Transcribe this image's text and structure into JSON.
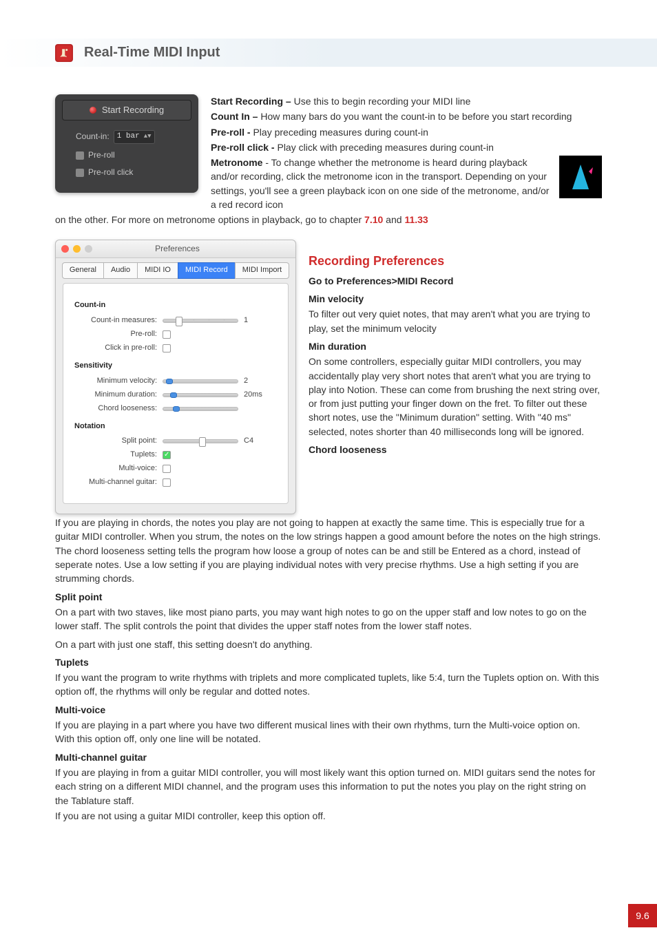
{
  "header": {
    "title": "Real-Time MIDI Input"
  },
  "startPanel": {
    "startBtn": "Start Recording",
    "countInLabel": "Count-in:",
    "countInValue": "1 bar",
    "preRoll": "Pre-roll",
    "preRollClick": "Pre-roll click"
  },
  "intro": {
    "startRec": {
      "b": "Start Recording – ",
      "t": "Use this to begin recording your MIDI line"
    },
    "countIn": {
      "b": "Count In – ",
      "t": "How many bars do you want the count-in to be before you start recording"
    },
    "preRoll": {
      "b": "Pre-roll - ",
      "t": "Play preceding measures during count-in"
    },
    "preRollClick": {
      "b": "Pre-roll click - ",
      "t": "Play click with preceding measures during count-in"
    },
    "metronome": {
      "b": "Metronome",
      "t": " - To change whether the metronome is heard during playback and/or recording, click the metronome icon in the transport. Depending on your settings, you'll see a green playback icon on one side of the metronome, and/or a red record icon"
    },
    "metronomeTail1": "on the other. For more on metronome options in playback, go to chapter ",
    "metronomeRef1": "7.10",
    "metronomeAnd": " and ",
    "metronomeRef2": "11.33"
  },
  "prefs": {
    "title": "Preferences",
    "tabs": [
      "General",
      "Audio",
      "MIDI IO",
      "MIDI Record",
      "MIDI Import"
    ],
    "activeTab": "MIDI Record",
    "groups": {
      "countIn": {
        "title": "Count-in",
        "measures": {
          "label": "Count-in measures:",
          "value": "1"
        },
        "preRoll": {
          "label": "Pre-roll:"
        },
        "clickPre": {
          "label": "Click in pre-roll:"
        }
      },
      "sensitivity": {
        "title": "Sensitivity",
        "minVel": {
          "label": "Minimum velocity:",
          "value": "2"
        },
        "minDur": {
          "label": "Minimum duration:",
          "value": "20ms"
        },
        "chord": {
          "label": "Chord looseness:"
        }
      },
      "notation": {
        "title": "Notation",
        "split": {
          "label": "Split point:",
          "value": "C4"
        },
        "tuplets": {
          "label": "Tuplets:"
        },
        "multiVoice": {
          "label": "Multi-voice:"
        },
        "mcg": {
          "label": "Multi-channel guitar:"
        }
      }
    }
  },
  "rec": {
    "heading": "Recording Preferences",
    "goto": "Go to Preferences>MIDI Record",
    "minVelH": "Min velocity",
    "minVelT": "To filter out very quiet notes, that may aren't what you are trying to play, set the minimum velocity",
    "minDurH": "Min duration",
    "minDurT": "On some controllers, especially guitar MIDI controllers, you may accidentally play very short notes that aren't what you are trying to play into Notion.  These can come from brushing the next string over, or from just putting your finger down on the fret.  To filter out these short notes, use the \"Minimum duration\" setting.  With \"40 ms\" selected, notes shorter than 40 milliseconds long will be ignored.",
    "chordH": "Chord looseness",
    "chordT": "If you are playing in chords, the notes you play are not going to happen at exactly the same time.  This is especially true for a guitar MIDI controller.  When you strum, the notes on the low strings happen a good amount before the notes on the high strings.  The chord looseness setting tells the program how loose a group of notes can be and still be Entered as a chord, instead of seperate notes. Use a low setting if you are playing individual notes with very precise rhythms.  Use a high setting if you are strumming chords.",
    "splitH": "Split point",
    "splitT1": "On a part with two staves, like most piano parts, you may want high notes to go on the upper staff and low notes to go on the lower staff.  The split controls the point that divides the upper staff notes from the lower staff notes.",
    "splitT2": "On a part with just one staff, this setting doesn't do anything.",
    "tupH": "Tuplets",
    "tupT": "If you want the program to write rhythms with triplets and more complicated tuplets, like 5:4, turn the Tuplets option on.  With this option off, the rhythms will only be regular and dotted notes.",
    "mvH": "Multi-voice",
    "mvT": "If you are playing in a part where you have two different musical lines with their own rhythms, turn the Multi-voice option on.  With this option off, only one line will be notated.",
    "mcgH": "Multi-channel guitar",
    "mcgT1": "If you are playing in from a guitar MIDI controller, you will most likely want this option turned on.  MIDI guitars send the notes for each string on a different MIDI channel, and the program uses this information to put the notes you play on the right string on the Tablature staff.",
    "mcgT2": "If you are not using a guitar MIDI controller, keep this option off."
  },
  "pageNum": "9.6"
}
